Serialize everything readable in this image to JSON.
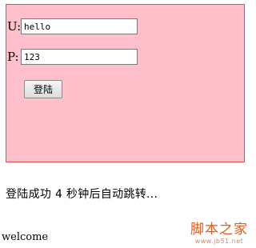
{
  "form": {
    "username_label": "U:",
    "username_value": "hello",
    "password_label": "P:",
    "password_value": "123",
    "submit_label": "登陆"
  },
  "status": {
    "message": "登陆成功 4 秒钟后自动跳转..."
  },
  "page": {
    "welcome": "welcome"
  },
  "watermark": {
    "title": "脚本之家",
    "url": "www.jb51.net"
  },
  "colors": {
    "form_background": "#ffc0cb",
    "form_border": "#e05050",
    "watermark": "#e35b1a"
  }
}
